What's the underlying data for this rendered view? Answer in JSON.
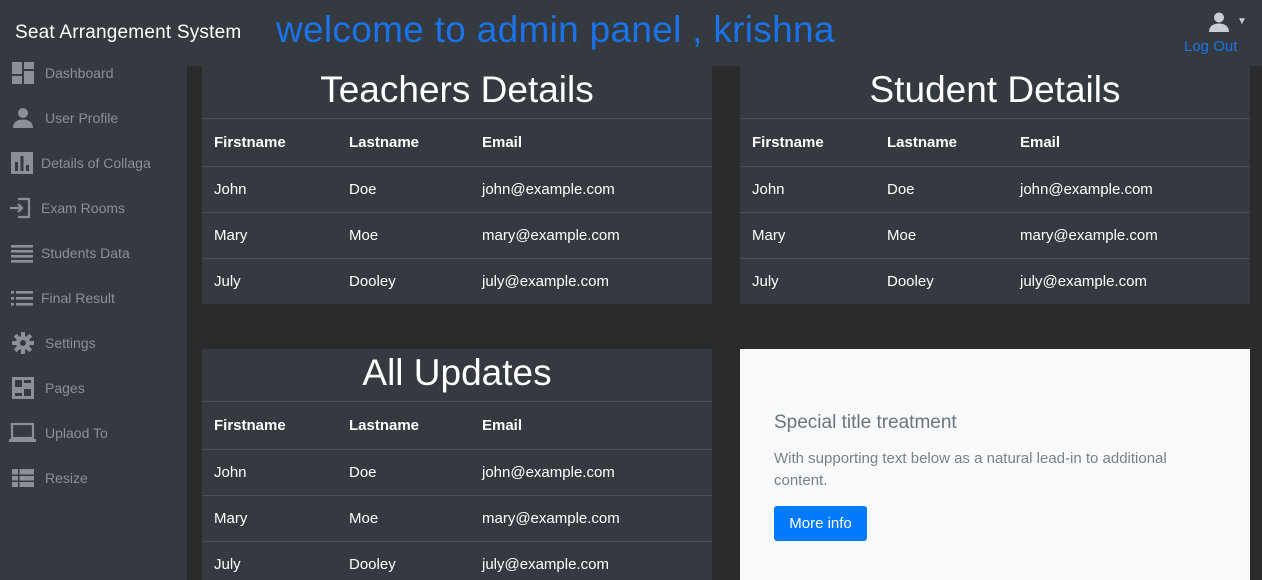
{
  "header": {
    "brand": "Seat Arrangement System",
    "welcome": "welcome to admin panel , krishna",
    "logout_label": "Log Out"
  },
  "sidebar": {
    "items": [
      {
        "label": "Dashboard",
        "icon": "dashboard-icon"
      },
      {
        "label": "User Profile",
        "icon": "user-icon"
      },
      {
        "label": "Details of Collaga",
        "icon": "bar-chart-icon"
      },
      {
        "label": "Exam Rooms",
        "icon": "sign-in-icon"
      },
      {
        "label": "Students Data",
        "icon": "lines-icon"
      },
      {
        "label": "Final Result",
        "icon": "list-icon"
      },
      {
        "label": "Settings",
        "icon": "gear-icon"
      },
      {
        "label": "Pages",
        "icon": "pages-icon"
      },
      {
        "label": "Uplaod To",
        "icon": "laptop-icon"
      },
      {
        "label": "Resize",
        "icon": "table-icon"
      }
    ]
  },
  "teachers": {
    "title": "Teachers Details",
    "columns": [
      "Firstname",
      "Lastname",
      "Email"
    ],
    "rows": [
      [
        "John",
        "Doe",
        "john@example.com"
      ],
      [
        "Mary",
        "Moe",
        "mary@example.com"
      ],
      [
        "July",
        "Dooley",
        "july@example.com"
      ]
    ]
  },
  "students": {
    "title": "Student Details",
    "columns": [
      "Firstname",
      "Lastname",
      "Email"
    ],
    "rows": [
      [
        "John",
        "Doe",
        "john@example.com"
      ],
      [
        "Mary",
        "Moe",
        "mary@example.com"
      ],
      [
        "July",
        "Dooley",
        "july@example.com"
      ]
    ]
  },
  "updates": {
    "title": "All Updates",
    "columns": [
      "Firstname",
      "Lastname",
      "Email"
    ],
    "rows": [
      [
        "John",
        "Doe",
        "john@example.com"
      ],
      [
        "Mary",
        "Moe",
        "mary@example.com"
      ],
      [
        "July",
        "Dooley",
        "july@example.com"
      ]
    ]
  },
  "info_card": {
    "title": "Special title treatment",
    "text": "With supporting text below as a natural lead-in to additional content.",
    "button_label": "More info"
  },
  "colors": {
    "accent": "#1a73e8",
    "button": "#007bff",
    "panel": "#343a40"
  }
}
